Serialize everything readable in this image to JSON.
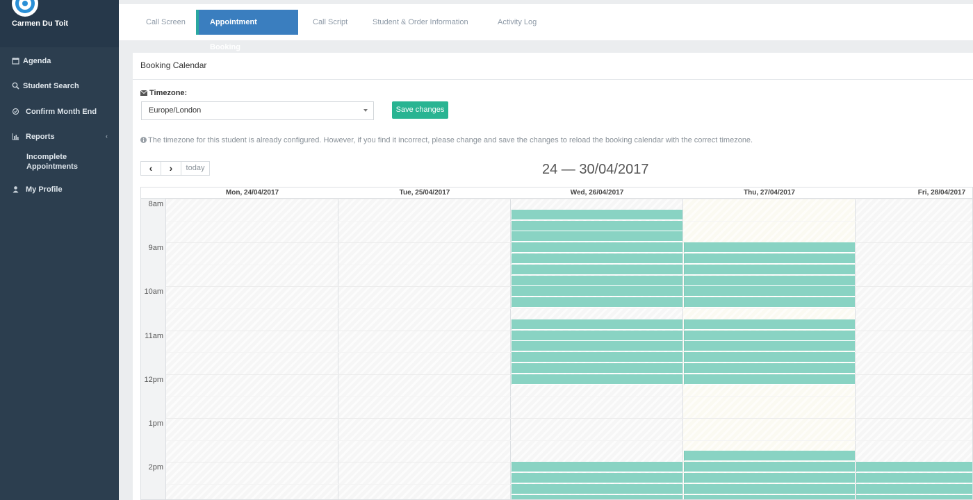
{
  "sidebar": {
    "user_name": "Carmen Du Toit",
    "items": [
      {
        "label": "Agenda",
        "icon": "calendar-icon"
      },
      {
        "label": "Student Search",
        "icon": "search-icon"
      },
      {
        "label": "Confirm Month End",
        "icon": "check-circle-icon"
      },
      {
        "label": "Reports",
        "icon": "bar-chart-icon"
      },
      {
        "label": "My Profile",
        "icon": "user-icon"
      }
    ],
    "sub_item": "Incomplete Appointments"
  },
  "tabs": [
    {
      "label": "Call Screen"
    },
    {
      "label": "Appointment Booking",
      "active": true
    },
    {
      "label": "Call Script"
    },
    {
      "label": "Student & Order Information"
    },
    {
      "label": "Activity Log"
    }
  ],
  "panel": {
    "title": "Booking Calendar",
    "timezone_label": "Timezone:",
    "timezone_value": "Europe/London",
    "save_label": "Save changes",
    "note": "The timezone for this student is already configured. However, if you find it incorrect, please change and save the changes to reload the booking calendar with the correct timezone."
  },
  "calendar": {
    "prev": "‹",
    "next": "›",
    "today_label": "today",
    "range_title": "24 — 30/04/2017",
    "days": [
      "Mon, 24/04/2017",
      "Tue, 25/04/2017",
      "Wed, 26/04/2017",
      "Thu, 27/04/2017",
      "Fri, 28/04/2017"
    ],
    "times": [
      "8am",
      "9am",
      "10am",
      "11am",
      "12pm",
      "1pm",
      "2pm"
    ]
  },
  "colors": {
    "sidebar_bg": "#2c3e4f",
    "active_tab": "#3a7ebf",
    "save_button": "#29b492",
    "available_slot": "#89d3c3"
  }
}
